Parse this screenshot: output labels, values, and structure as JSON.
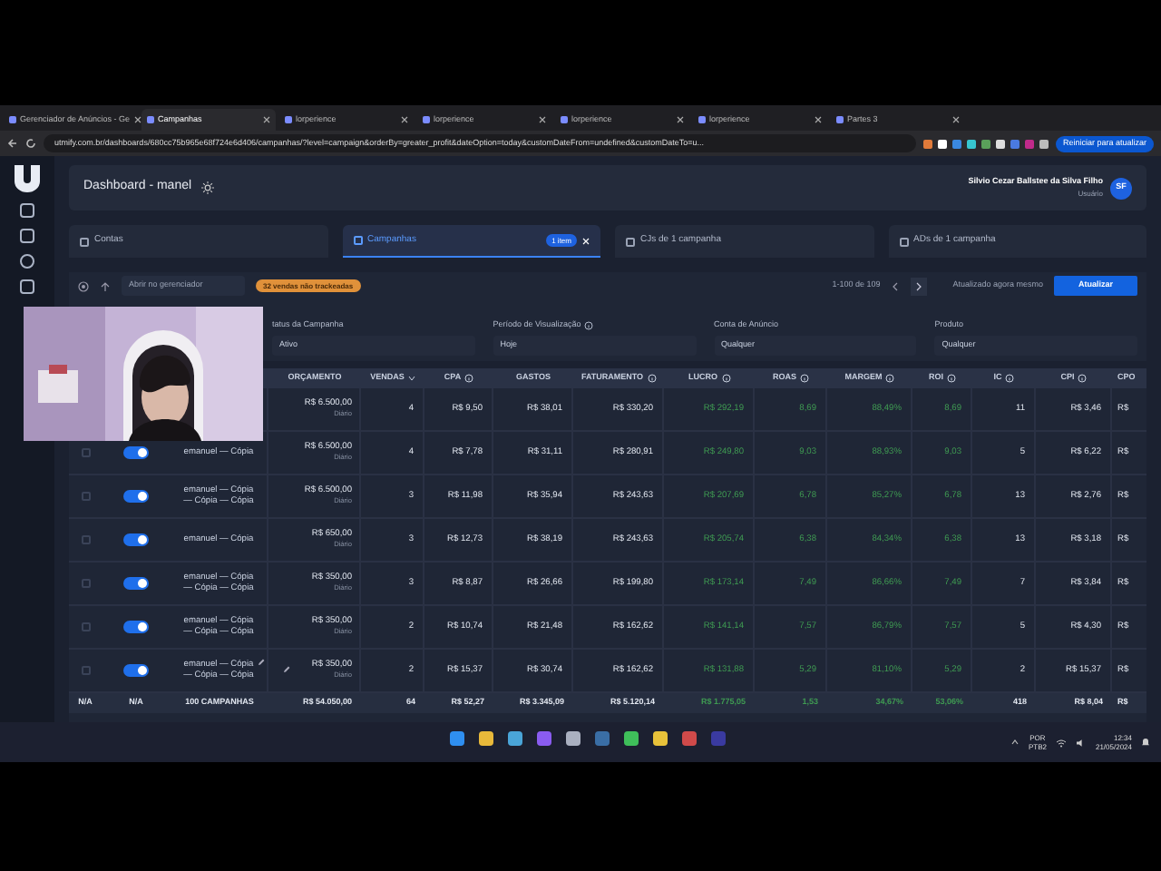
{
  "browser": {
    "tabs": [
      {
        "label": "Gerenciador de Anúncios - Ge",
        "selected": false
      },
      {
        "label": "Campanhas",
        "selected": true
      },
      {
        "label": "lorperience",
        "selected": false
      },
      {
        "label": "lorperience",
        "selected": false
      },
      {
        "label": "lorperience",
        "selected": false
      },
      {
        "label": "lorperience",
        "selected": false
      },
      {
        "label": "Partes 3",
        "selected": false
      }
    ],
    "url": "utmify.com.br/dashboards/680cc75b965e68f724e6d406/campanhas/?level=campaign&orderBy=greater_profit&dateOption=today&customDateFrom=undefined&customDateTo=u...",
    "update_button": "Reiniciar para atualizar"
  },
  "header": {
    "title": "Dashboard - manel",
    "user_name": "Silvio Cezar Ballstee da Silva Filho",
    "user_role": "Usuário",
    "avatar": "SF"
  },
  "level_tabs": [
    {
      "label": "Contas",
      "selected": false
    },
    {
      "label": "Campanhas",
      "selected": true,
      "badge": "1 item"
    },
    {
      "label": "CJs de 1 campanha",
      "selected": false
    },
    {
      "label": "ADs de 1 campanha",
      "selected": false
    }
  ],
  "toolbar": {
    "open_manager": "Abrir no gerenciador",
    "alert": "32 vendas não trackeadas",
    "pagination": "1-100 de 109",
    "updated": "Atualizado agora mesmo",
    "refresh": "Atualizar"
  },
  "filters": [
    {
      "label": "tatus da Campanha",
      "value": "Ativo"
    },
    {
      "label": "Período de Visualização",
      "value": "Hoje",
      "info": true
    },
    {
      "label": "Conta de Anúncio",
      "value": "Qualquer"
    },
    {
      "label": "Produto",
      "value": "Qualquer"
    }
  ],
  "table": {
    "budget_header": "ORÇAMENTO",
    "columns": [
      {
        "label": "VENDAS",
        "sorted": true
      },
      {
        "label": "CPA",
        "info": true
      },
      {
        "label": "GASTOS"
      },
      {
        "label": "FATURAMENTO",
        "info": true
      },
      {
        "label": "LUCRO",
        "info": true,
        "kind": "profit"
      },
      {
        "label": "ROAS",
        "info": true,
        "kind": "profit"
      },
      {
        "label": "MARGEM",
        "info": true,
        "kind": "profit"
      },
      {
        "label": "ROI",
        "info": true,
        "kind": "profit"
      },
      {
        "label": "IC",
        "info": true
      },
      {
        "label": "CPI",
        "info": true
      },
      {
        "label": "CPO"
      }
    ],
    "rows": [
      {
        "budget": "R$ 6.500,00",
        "budget_period": "Diário",
        "cells": [
          "4",
          "R$ 9,50",
          "R$ 38,01",
          "R$ 330,20",
          "R$ 292,19",
          "8,69",
          "88,49%",
          "8,69",
          "11",
          "R$ 3,46",
          "R$"
        ]
      },
      {
        "checked": false,
        "active": true,
        "name": "emanuel — Cópia",
        "budget": "R$ 6.500,00",
        "budget_period": "Diário",
        "cells": [
          "4",
          "R$ 7,78",
          "R$ 31,11",
          "R$ 280,91",
          "R$ 249,80",
          "9,03",
          "88,93%",
          "9,03",
          "5",
          "R$ 6,22",
          "R$"
        ]
      },
      {
        "checked": false,
        "active": true,
        "name": "emanuel — Cópia — Cópia — Cópia",
        "budget": "R$ 6.500,00",
        "budget_period": "Diário",
        "cells": [
          "3",
          "R$ 11,98",
          "R$ 35,94",
          "R$ 243,63",
          "R$ 207,69",
          "6,78",
          "85,27%",
          "6,78",
          "13",
          "R$ 2,76",
          "R$"
        ]
      },
      {
        "checked": false,
        "active": true,
        "name": "emanuel — Cópia",
        "budget": "R$ 650,00",
        "budget_period": "Diário",
        "cells": [
          "3",
          "R$ 12,73",
          "R$ 38,19",
          "R$ 243,63",
          "R$ 205,74",
          "6,38",
          "84,34%",
          "6,38",
          "13",
          "R$ 3,18",
          "R$"
        ]
      },
      {
        "checked": false,
        "active": true,
        "name": "emanuel — Cópia — Cópia — Cópia",
        "budget": "R$ 350,00",
        "budget_period": "Diário",
        "cells": [
          "3",
          "R$ 8,87",
          "R$ 26,66",
          "R$ 199,80",
          "R$ 173,14",
          "7,49",
          "86,66%",
          "7,49",
          "7",
          "R$ 3,84",
          "R$"
        ]
      },
      {
        "checked": false,
        "active": true,
        "name": "emanuel — Cópia — Cópia — Cópia",
        "budget": "R$ 350,00",
        "budget_period": "Diário",
        "cells": [
          "2",
          "R$ 10,74",
          "R$ 21,48",
          "R$ 162,62",
          "R$ 141,14",
          "7,57",
          "86,79%",
          "7,57",
          "5",
          "R$ 4,30",
          "R$"
        ]
      },
      {
        "checked": false,
        "active": true,
        "name": "emanuel — Cópia — Cópia — Cópia",
        "budget": "R$ 350,00",
        "budget_period": "Diário",
        "editable": true,
        "cells": [
          "2",
          "R$ 15,37",
          "R$ 30,74",
          "R$ 162,62",
          "R$ 131,88",
          "5,29",
          "81,10%",
          "5,29",
          "2",
          "R$ 15,37",
          "R$"
        ]
      }
    ],
    "totals": [
      "N/A",
      "N/A",
      "100 CAMPANHAS",
      "R$ 54.050,00",
      "64",
      "R$ 52,27",
      "R$ 3.345,09",
      "R$ 5.120,14",
      "R$ 1.775,05",
      "1,53",
      "34,67%",
      "53,06%",
      "418",
      "R$ 8,04",
      "R$"
    ]
  },
  "taskbar": {
    "language": "POR",
    "layout": "PTB2",
    "time": "12:34",
    "date": "21/05/2024"
  }
}
